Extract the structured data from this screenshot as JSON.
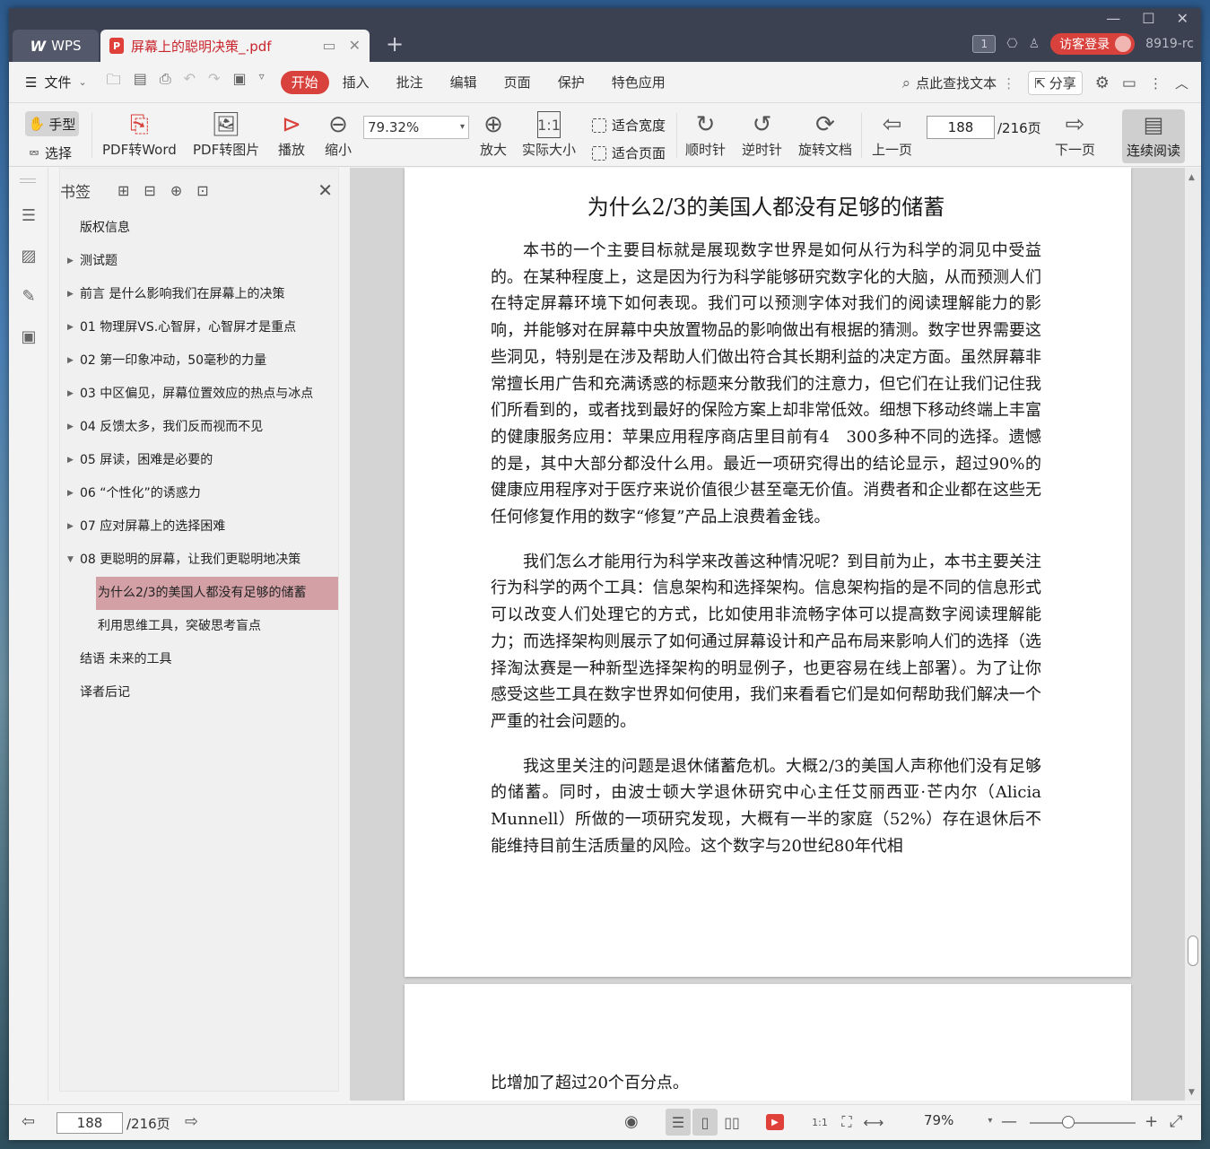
{
  "tabs": {
    "wps": {
      "logo": "W",
      "label": "WPS"
    },
    "document": {
      "title": "屏幕上的聪明决策_.pdf"
    }
  },
  "title_bar": {
    "window_badge": "1",
    "login_label": "访客登录",
    "version": "8919-rc"
  },
  "menu": {
    "file_label": "文件",
    "tabs": [
      "开始",
      "插入",
      "批注",
      "编辑",
      "页面",
      "保护",
      "特色应用"
    ],
    "active_tab": "开始",
    "search_placeholder": "点此查找文本",
    "share_label": "分享"
  },
  "toolbar": {
    "hand_label": "手型",
    "select_label": "选择",
    "pdf_to_word": "PDF转Word",
    "pdf_to_image": "PDF转图片",
    "play": "播放",
    "zoom_out": "缩小",
    "zoom_value": "79.32%",
    "zoom_in": "放大",
    "actual_size": "实际大小",
    "fit_width": "适合宽度",
    "fit_page": "适合页面",
    "clockwise": "顺时针",
    "counter_clockwise": "逆时针",
    "rotate_doc": "旋转文档",
    "prev_page": "上一页",
    "current_page": "188",
    "total_pages": "/216页",
    "next_page": "下一页",
    "continuous_read": "连续阅读"
  },
  "bookmarks": {
    "title": "书签",
    "items": [
      {
        "label": "版权信息",
        "expandable": false,
        "level": 0
      },
      {
        "label": "测试题",
        "expandable": true,
        "level": 0
      },
      {
        "label": "前言 是什么影响我们在屏幕上的决策",
        "expandable": true,
        "level": 0
      },
      {
        "label": "01 物理屏VS.心智屏，心智屏才是重点",
        "expandable": true,
        "level": 0
      },
      {
        "label": "02 第一印象冲动，50毫秒的力量",
        "expandable": true,
        "level": 0
      },
      {
        "label": "03 中区偏见，屏幕位置效应的热点与冰点",
        "expandable": true,
        "level": 0
      },
      {
        "label": "04 反馈太多，我们反而视而不见",
        "expandable": true,
        "level": 0
      },
      {
        "label": "05 屏读，困难是必要的",
        "expandable": true,
        "level": 0
      },
      {
        "label": "06 “个性化”的诱惑力",
        "expandable": true,
        "level": 0
      },
      {
        "label": "07 应对屏幕上的选择困难",
        "expandable": true,
        "level": 0
      },
      {
        "label": "08 更聪明的屏幕，让我们更聪明地决策",
        "expandable": true,
        "expanded": true,
        "level": 0
      },
      {
        "label": "为什么2/3的美国人都没有足够的储蓄",
        "level": 1,
        "selected": true
      },
      {
        "label": "利用思维工具，突破思考盲点",
        "level": 1
      },
      {
        "label": "结语 未来的工具",
        "expandable": false,
        "level": 0
      },
      {
        "label": "译者后记",
        "expandable": false,
        "level": 0
      }
    ]
  },
  "document": {
    "page_title": "为什么2/3的美国人都没有足够的储蓄",
    "paragraphs": [
      "本书的一个主要目标就是展现数字世界是如何从行为科学的洞见中受益的。在某种程度上，这是因为行为科学能够研究数字化的大脑，从而预测人们在特定屏幕环境下如何表现。我们可以预测字体对我们的阅读理解能力的影响，并能够对在屏幕中央放置物品的影响做出有根据的猜测。数字世界需要这些洞见，特别是在涉及帮助人们做出符合其长期利益的决定方面。虽然屏幕非常擅长用广告和充满诱惑的标题来分散我们的注意力，但它们在让我们记住我们所看到的，或者找到最好的保险方案上却非常低效。细想下移动终端上丰富的健康服务应用：苹果应用程序商店里目前有4　300多种不同的选择。遗憾的是，其中大部分都没什么用。最近一项研究得出的结论显示，超过90%的健康应用程序对于医疗来说价值很少甚至毫无价值。消费者和企业都在这些无任何修复作用的数字“修复”产品上浪费着金钱。",
      "我们怎么才能用行为科学来改善这种情况呢？到目前为止，本书主要关注行为科学的两个工具：信息架构和选择架构。信息架构指的是不同的信息形式可以改变人们处理它的方式，比如使用非流畅字体可以提高数字阅读理解能力；而选择架构则展示了如何通过屏幕设计和产品布局来影响人们的选择（选择淘汰赛是一种新型选择架构的明显例子，也更容易在线上部署）。为了让你感受这些工具在数字世界如何使用，我们来看看它们是如何帮助我们解决一个严重的社会问题的。",
      "我这里关注的问题是退休储蓄危机。大概2/3的美国人声称他们没有足够的储蓄。同时，由波士顿大学退休研究中心主任艾丽西亚·芒内尔（Alicia Munnell）所做的一项研究发现，大概有一半的家庭（52%）存在退休后不能维持目前生活质量的风险。这个数字与20世纪80年代相"
    ],
    "next_page_text": "比增加了超过20个百分点。"
  },
  "statusbar": {
    "current_page": "188",
    "total_pages": "/216页",
    "zoom": "79%"
  },
  "colors": {
    "accent": "#d9423c",
    "titlebar": "#3c4151",
    "selected_bookmark": "#d3a0a6"
  }
}
